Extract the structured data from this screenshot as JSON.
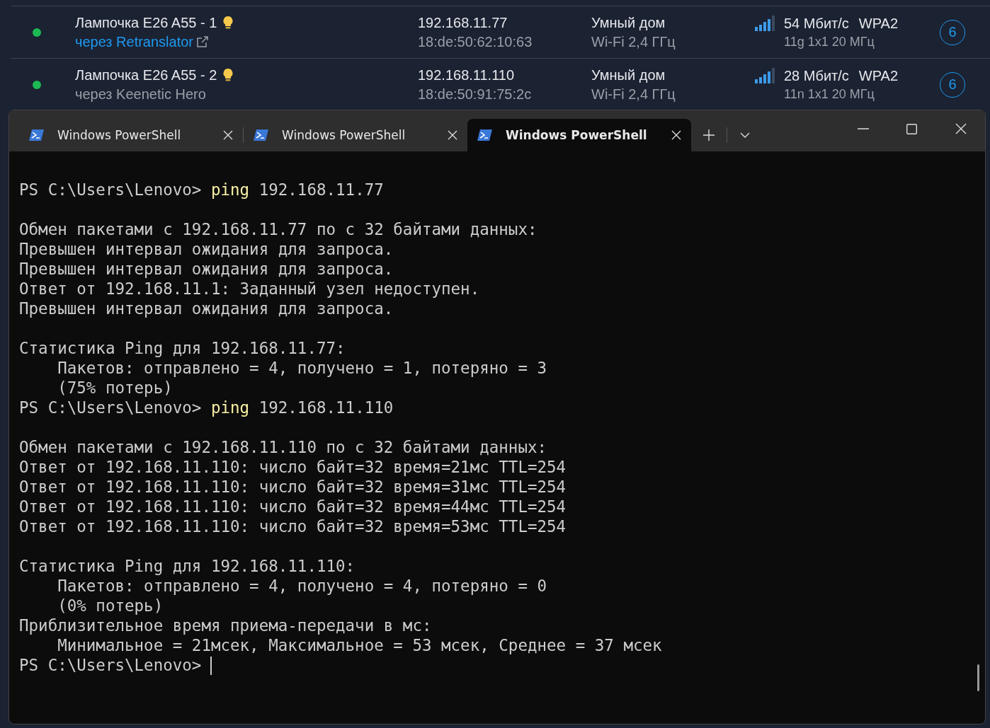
{
  "devices": [
    {
      "color": "#1db954",
      "name": "Лампочка E26 A55 - 1",
      "via": "через Retranslator",
      "via_link": true,
      "ip": "192.168.11.77",
      "mac": "18:de:50:62:10:63",
      "segment": "Умный дом",
      "band": "Wi-Fi 2,4 ГГц",
      "rate": "54 Мбит/с",
      "security": "WPA2",
      "mode": "11g 1x1 20 МГц",
      "channel": "6"
    },
    {
      "color": "#1db954",
      "name": "Лампочка E26 A55 - 2",
      "via": "через Keenetic Hero",
      "via_link": false,
      "ip": "192.168.11.110",
      "mac": "18:de:50:91:75:2c",
      "segment": "Умный дом",
      "band": "Wi-Fi 2,4 ГГц",
      "rate": "28 Мбит/с",
      "security": "WPA2",
      "mode": "11n 1x1 20 МГц",
      "channel": "6"
    }
  ],
  "terminal": {
    "tabs": [
      {
        "title": "Windows PowerShell",
        "selected": false
      },
      {
        "title": "Windows PowerShell",
        "selected": false
      },
      {
        "title": "Windows PowerShell",
        "selected": true
      }
    ],
    "lines": [
      {
        "kind": "blank"
      },
      {
        "kind": "prompt",
        "prompt": "PS C:\\Users\\Lenovo>",
        "command": "ping",
        "args": "192.168.11.77"
      },
      {
        "kind": "blank"
      },
      {
        "kind": "output",
        "text": "Обмен пакетами с 192.168.11.77 по с 32 байтами данных:"
      },
      {
        "kind": "output",
        "text": "Превышен интервал ожидания для запроса."
      },
      {
        "kind": "output",
        "text": "Превышен интервал ожидания для запроса."
      },
      {
        "kind": "output",
        "text": "Ответ от 192.168.11.1: Заданный узел недоступен."
      },
      {
        "kind": "output",
        "text": "Превышен интервал ожидания для запроса."
      },
      {
        "kind": "blank"
      },
      {
        "kind": "output",
        "text": "Статистика Ping для 192.168.11.77:"
      },
      {
        "kind": "output",
        "text": "    Пакетов: отправлено = 4, получено = 1, потеряно = 3"
      },
      {
        "kind": "output",
        "text": "    (75% потерь)"
      },
      {
        "kind": "prompt",
        "prompt": "PS C:\\Users\\Lenovo>",
        "command": "ping",
        "args": "192.168.11.110"
      },
      {
        "kind": "blank"
      },
      {
        "kind": "output",
        "text": "Обмен пакетами с 192.168.11.110 по с 32 байтами данных:"
      },
      {
        "kind": "output",
        "text": "Ответ от 192.168.11.110: число байт=32 время=21мс TTL=254"
      },
      {
        "kind": "output",
        "text": "Ответ от 192.168.11.110: число байт=32 время=31мс TTL=254"
      },
      {
        "kind": "output",
        "text": "Ответ от 192.168.11.110: число байт=32 время=44мс TTL=254"
      },
      {
        "kind": "output",
        "text": "Ответ от 192.168.11.110: число байт=32 время=53мс TTL=254"
      },
      {
        "kind": "blank"
      },
      {
        "kind": "output",
        "text": "Статистика Ping для 192.168.11.110:"
      },
      {
        "kind": "output",
        "text": "    Пакетов: отправлено = 4, получено = 4, потеряно = 0"
      },
      {
        "kind": "output",
        "text": "    (0% потерь)"
      },
      {
        "kind": "output",
        "text": "Приблизительное время приема-передачи в мс:"
      },
      {
        "kind": "output",
        "text": "    Минимальное = 21мсек, Максимальное = 53 мсек, Среднее = 37 мсек"
      },
      {
        "kind": "cursor",
        "prompt": "PS C:\\Users\\Lenovo>"
      }
    ]
  }
}
